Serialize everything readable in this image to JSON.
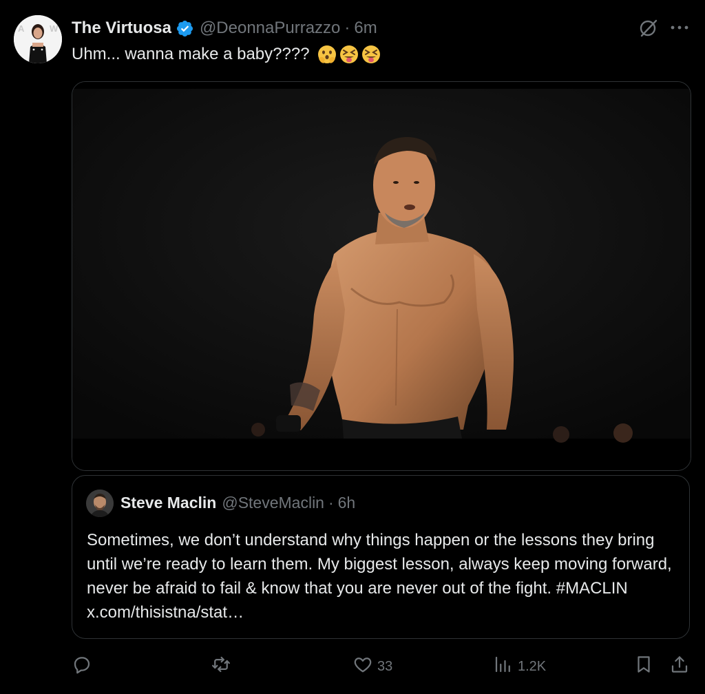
{
  "post": {
    "display_name": "The Virtuosa",
    "handle": "@DeonnaPurrazzo",
    "separator": "·",
    "time": "6m",
    "text": "Uhm... wanna make a baby????",
    "emojis": [
      "astonished-face-hands",
      "squinting-tongue-face",
      "squinting-tongue-face"
    ],
    "verified": true
  },
  "quote": {
    "display_name": "Steve Maclin",
    "handle": "@SteveMaclin",
    "separator": "·",
    "time": "6h",
    "text": "Sometimes, we don’t understand why things happen or the lessons they bring until we’re ready to learn them. My biggest lesson, always keep moving forward, never be afraid to fail & know that you are never out of the fight. #MACLIN x.com/thisistna/stat…"
  },
  "actions": {
    "reply": "",
    "repost": "",
    "likes": "33",
    "views": "1.2K"
  },
  "colors": {
    "background": "#000000",
    "text": "#e7e9ea",
    "muted": "#71767b",
    "border": "#2f3336",
    "verified": "#1d9bf0"
  },
  "icons": {
    "verified": "verified-badge-icon",
    "grok": "grok-icon",
    "more": "more-dots-icon",
    "reply": "reply-icon",
    "repost": "repost-icon",
    "like": "heart-icon",
    "views": "views-icon",
    "bookmark": "bookmark-icon",
    "share": "share-icon"
  }
}
